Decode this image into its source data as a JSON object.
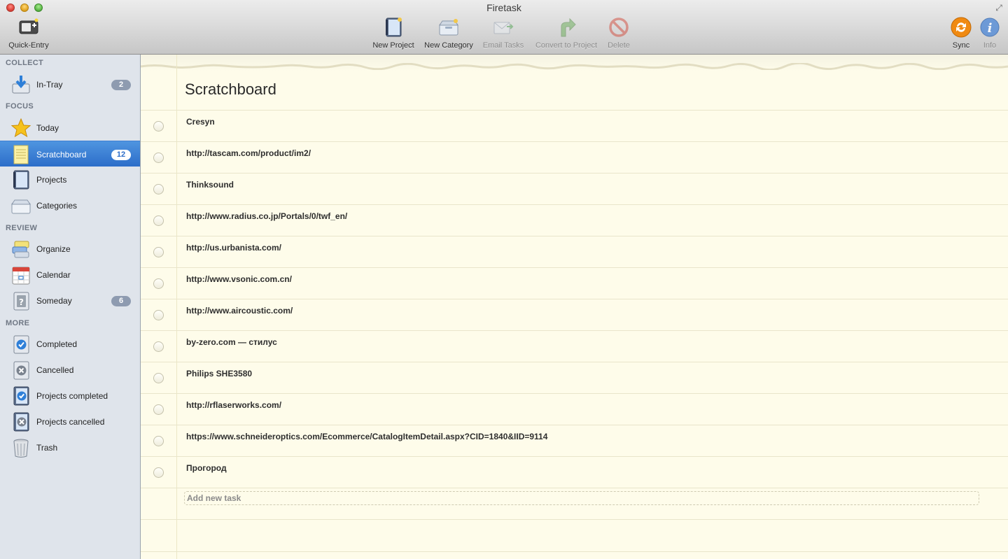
{
  "window": {
    "title": "Firetask"
  },
  "toolbar": {
    "quick_entry": "Quick-Entry",
    "new_project": "New Project",
    "new_category": "New Category",
    "email_tasks": "Email Tasks",
    "convert_to_project": "Convert to Project",
    "delete": "Delete",
    "sync": "Sync",
    "info": "Info"
  },
  "sidebar": {
    "collect_header": "COLLECT",
    "focus_header": "FOCUS",
    "review_header": "REVIEW",
    "more_header": "MORE",
    "in_tray": {
      "label": "In-Tray",
      "badge": "2"
    },
    "today": {
      "label": "Today"
    },
    "scratchboard": {
      "label": "Scratchboard",
      "badge": "12"
    },
    "projects": {
      "label": "Projects"
    },
    "categories": {
      "label": "Categories"
    },
    "organize": {
      "label": "Organize"
    },
    "calendar": {
      "label": "Calendar"
    },
    "someday": {
      "label": "Someday",
      "badge": "6"
    },
    "completed": {
      "label": "Completed"
    },
    "cancelled": {
      "label": "Cancelled"
    },
    "projects_completed": {
      "label": "Projects completed"
    },
    "projects_cancelled": {
      "label": "Projects cancelled"
    },
    "trash": {
      "label": "Trash"
    }
  },
  "main": {
    "title": "Scratchboard",
    "tasks": [
      "Cresyn",
      "http://tascam.com/product/im2/",
      "Thinksound",
      "http://www.radius.co.jp/Portals/0/twf_en/",
      "http://us.urbanista.com/",
      "http://www.vsonic.com.cn/",
      "http://www.aircoustic.com/",
      "by-zero.com — стилус",
      "Philips SHE3580",
      "http://rflaserworks.com/",
      "https://www.schneideroptics.com/Ecommerce/CatalogItemDetail.aspx?CID=1840&IID=9114",
      "Прогород"
    ],
    "new_task_placeholder": "Add new task"
  },
  "colors": {
    "selection": "#2c6dc9",
    "sidebar_bg": "#dfe4eb",
    "paper_bg": "#fefcea",
    "sync_orange": "#f08a12",
    "info_blue": "#5a8fd6"
  }
}
